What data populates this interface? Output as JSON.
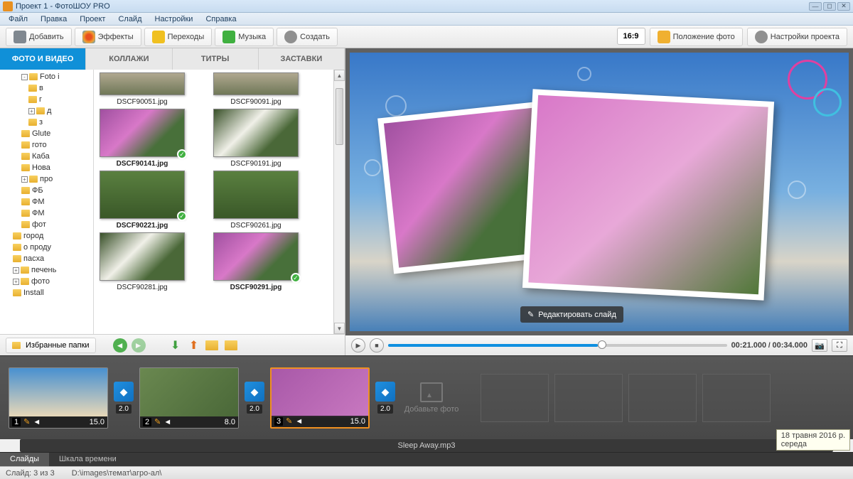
{
  "window": {
    "title": "Проект 1 - ФотоШОУ PRO"
  },
  "menu": [
    "Файл",
    "Правка",
    "Проект",
    "Слайд",
    "Настройки",
    "Справка"
  ],
  "toolbar": {
    "add": "Добавить",
    "effects": "Эффекты",
    "transitions": "Переходы",
    "music": "Музыка",
    "create": "Создать",
    "ratio": "16:9",
    "position": "Положение фото",
    "settings": "Настройки проекта"
  },
  "tabs": {
    "photo_video": "ФОТО И ВИДЕО",
    "collages": "КОЛЛАЖИ",
    "titles": "ТИТРЫ",
    "intros": "ЗАСТАВКИ"
  },
  "tree": [
    {
      "label": "Foto і",
      "depth": 2,
      "exp": "-"
    },
    {
      "label": "в",
      "depth": 3
    },
    {
      "label": "г",
      "depth": 3
    },
    {
      "label": "д",
      "depth": 3,
      "exp": "+"
    },
    {
      "label": "з",
      "depth": 3
    },
    {
      "label": "Glute",
      "depth": 2
    },
    {
      "label": "гото",
      "depth": 2
    },
    {
      "label": "Каба",
      "depth": 2
    },
    {
      "label": "Нова",
      "depth": 2
    },
    {
      "label": "про",
      "depth": 2,
      "exp": "+"
    },
    {
      "label": "ФБ",
      "depth": 2
    },
    {
      "label": "ФМ",
      "depth": 2
    },
    {
      "label": "ФМ",
      "depth": 2
    },
    {
      "label": "фот",
      "depth": 2
    },
    {
      "label": "город",
      "depth": 1
    },
    {
      "label": "о проду",
      "depth": 1
    },
    {
      "label": "пасха",
      "depth": 1
    },
    {
      "label": "печень",
      "depth": 1,
      "exp": "+"
    },
    {
      "label": "фото",
      "depth": 1,
      "exp": "+"
    },
    {
      "label": "Install",
      "depth": 1
    }
  ],
  "thumbs": [
    [
      {
        "name": "DSCF90051.jpg",
        "style": "flower-urban",
        "half": true
      },
      {
        "name": "DSCF90091.jpg",
        "style": "flower-urban",
        "half": true
      }
    ],
    [
      {
        "name": "DSCF90141.jpg",
        "style": "flower-pink",
        "sel": true,
        "check": true
      },
      {
        "name": "DSCF90191.jpg",
        "style": "flower-white"
      }
    ],
    [
      {
        "name": "DSCF90221.jpg",
        "style": "flower-grass",
        "sel": true,
        "check": true
      },
      {
        "name": "DSCF90261.jpg",
        "style": "flower-grass"
      }
    ],
    [
      {
        "name": "DSCF90281.jpg",
        "style": "flower-white"
      },
      {
        "name": "DSCF90291.jpg",
        "style": "flower-pink",
        "sel": true,
        "check": true
      }
    ]
  ],
  "favorites": "Избранные папки",
  "preview": {
    "edit": "Редактировать слайд"
  },
  "playback": {
    "current": "00:21.000",
    "total": "00:34.000"
  },
  "slides": [
    {
      "num": "1",
      "dur": "15.0",
      "trans": "2.0"
    },
    {
      "num": "2",
      "dur": "8.0",
      "trans": "2.0"
    },
    {
      "num": "3",
      "dur": "15.0",
      "trans": "2.0",
      "active": true
    }
  ],
  "add_photo": "Добавьте фото",
  "music_track": "Sleep Away.mp3",
  "bottom_tabs": {
    "slides": "Слайды",
    "timeline": "Шкала времени"
  },
  "status": {
    "slide": "Слайд: 3 из 3",
    "path": "D:\\images\\темат\\агро-ал\\"
  },
  "date_tip": "18 травня 2016 р.\nсереда"
}
